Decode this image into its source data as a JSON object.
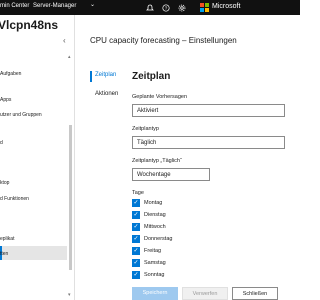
{
  "topbar": {
    "crumb_left": "min Center",
    "crumb_mid": "Server-Manager",
    "chevron": "⌄",
    "brand": "Microsoft",
    "icons": [
      "notifications-icon",
      "help-icon",
      "settings-icon"
    ],
    "logo_colors": [
      "#f25022",
      "#7fba00",
      "#00a4ef",
      "#ffb900"
    ]
  },
  "sidebar": {
    "server_name": "Vlcpn48ns",
    "collapse": "‹",
    "items": [
      {
        "label": "Aufgaben"
      },
      {
        "label": "Apps"
      },
      {
        "label": "utzer und Gruppen"
      },
      {
        "label": "d"
      },
      {
        "label": "ktop"
      },
      {
        "label": "d Funktionen"
      },
      {
        "label": "eplikat"
      },
      {
        "label": "tten"
      }
    ]
  },
  "page": {
    "title": "CPU capacity forecasting – Einstellungen",
    "nav": [
      "Zeitplan",
      "Aktionen"
    ],
    "section_title": "Zeitplan",
    "fields": {
      "scheduled_label": "Geplante Vorhersagen",
      "scheduled_value": "Aktiviert",
      "plan_type_label": "Zeitplantyp",
      "plan_type_value": "Täglich",
      "plan_type_daily_label": "Zeitplantyp „Täglich“",
      "plan_type_daily_value": "Wochentage",
      "days_label": "Tage"
    },
    "days": [
      {
        "label": "Montag",
        "checked": true
      },
      {
        "label": "Dienstag",
        "checked": true
      },
      {
        "label": "Mittwoch",
        "checked": true
      },
      {
        "label": "Donnerstag",
        "checked": true
      },
      {
        "label": "Freitag",
        "checked": true
      },
      {
        "label": "Samstag",
        "checked": true
      },
      {
        "label": "Sonntag",
        "checked": true
      }
    ],
    "buttons": {
      "save": "Speichern",
      "discard": "Verwerfen",
      "close": "Schließen"
    }
  },
  "colors": {
    "accent": "#0078d4",
    "topbar": "#111111",
    "disabled_primary": "#9ec9ef"
  }
}
